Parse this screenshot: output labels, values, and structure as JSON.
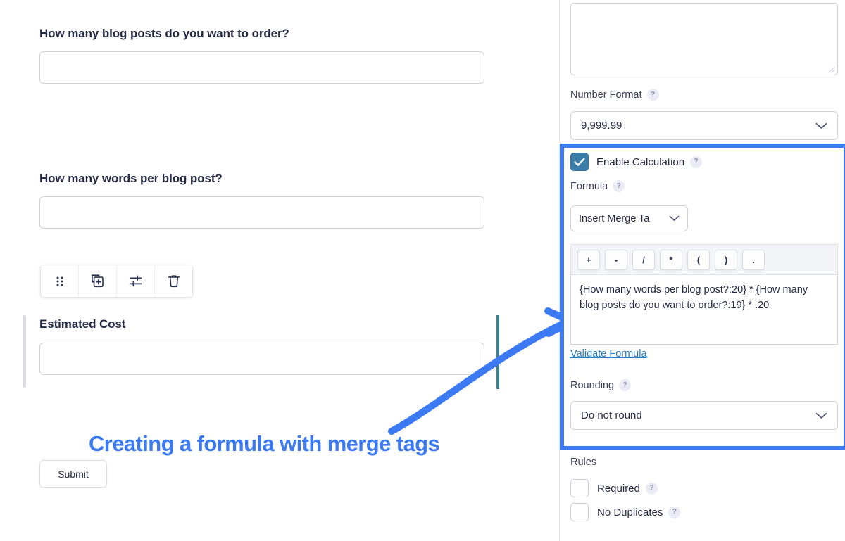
{
  "form": {
    "fields": [
      {
        "label": "How many blog posts do you want to order?",
        "value": ""
      },
      {
        "label": "How many words per blog post?",
        "value": ""
      },
      {
        "label": "Estimated Cost",
        "value": ""
      }
    ],
    "toolbar": {
      "drag_label": "drag-handle",
      "duplicate_label": "duplicate-field",
      "settings_label": "field-settings",
      "delete_label": "delete-field"
    },
    "submit_label": "Submit"
  },
  "caption": {
    "text": "Creating a formula with merge tags",
    "color": "#3b7af2"
  },
  "settings": {
    "description_textarea": {
      "value": "",
      "placeholder": ""
    },
    "number_format": {
      "label": "Number Format",
      "help": "?",
      "selected": "9,999.99"
    },
    "calculation": {
      "enable_label": "Enable Calculation",
      "enable_help": "?",
      "enabled": true,
      "formula_label": "Formula",
      "formula_help": "?",
      "merge_tag_button": "Insert Merge Ta",
      "operators": [
        "+",
        "-",
        "/",
        "*",
        "(",
        ")",
        "."
      ],
      "formula_value": "{How many words per blog post?:20} * {How many blog posts do you want to order?:19} * .20",
      "validate_link": "Validate Formula",
      "rounding_label": "Rounding",
      "rounding_help": "?",
      "rounding_selected": "Do not round"
    },
    "rules": {
      "heading": "Rules",
      "items": [
        {
          "label": "Required",
          "help": "?",
          "checked": false
        },
        {
          "label": "No Duplicates",
          "help": "?",
          "checked": false
        }
      ]
    }
  },
  "colors": {
    "highlight": "#3b7af2",
    "checkbox_on": "#3b7ca8",
    "teal_guide": "#3e7f95",
    "link": "#2b7bb9"
  }
}
